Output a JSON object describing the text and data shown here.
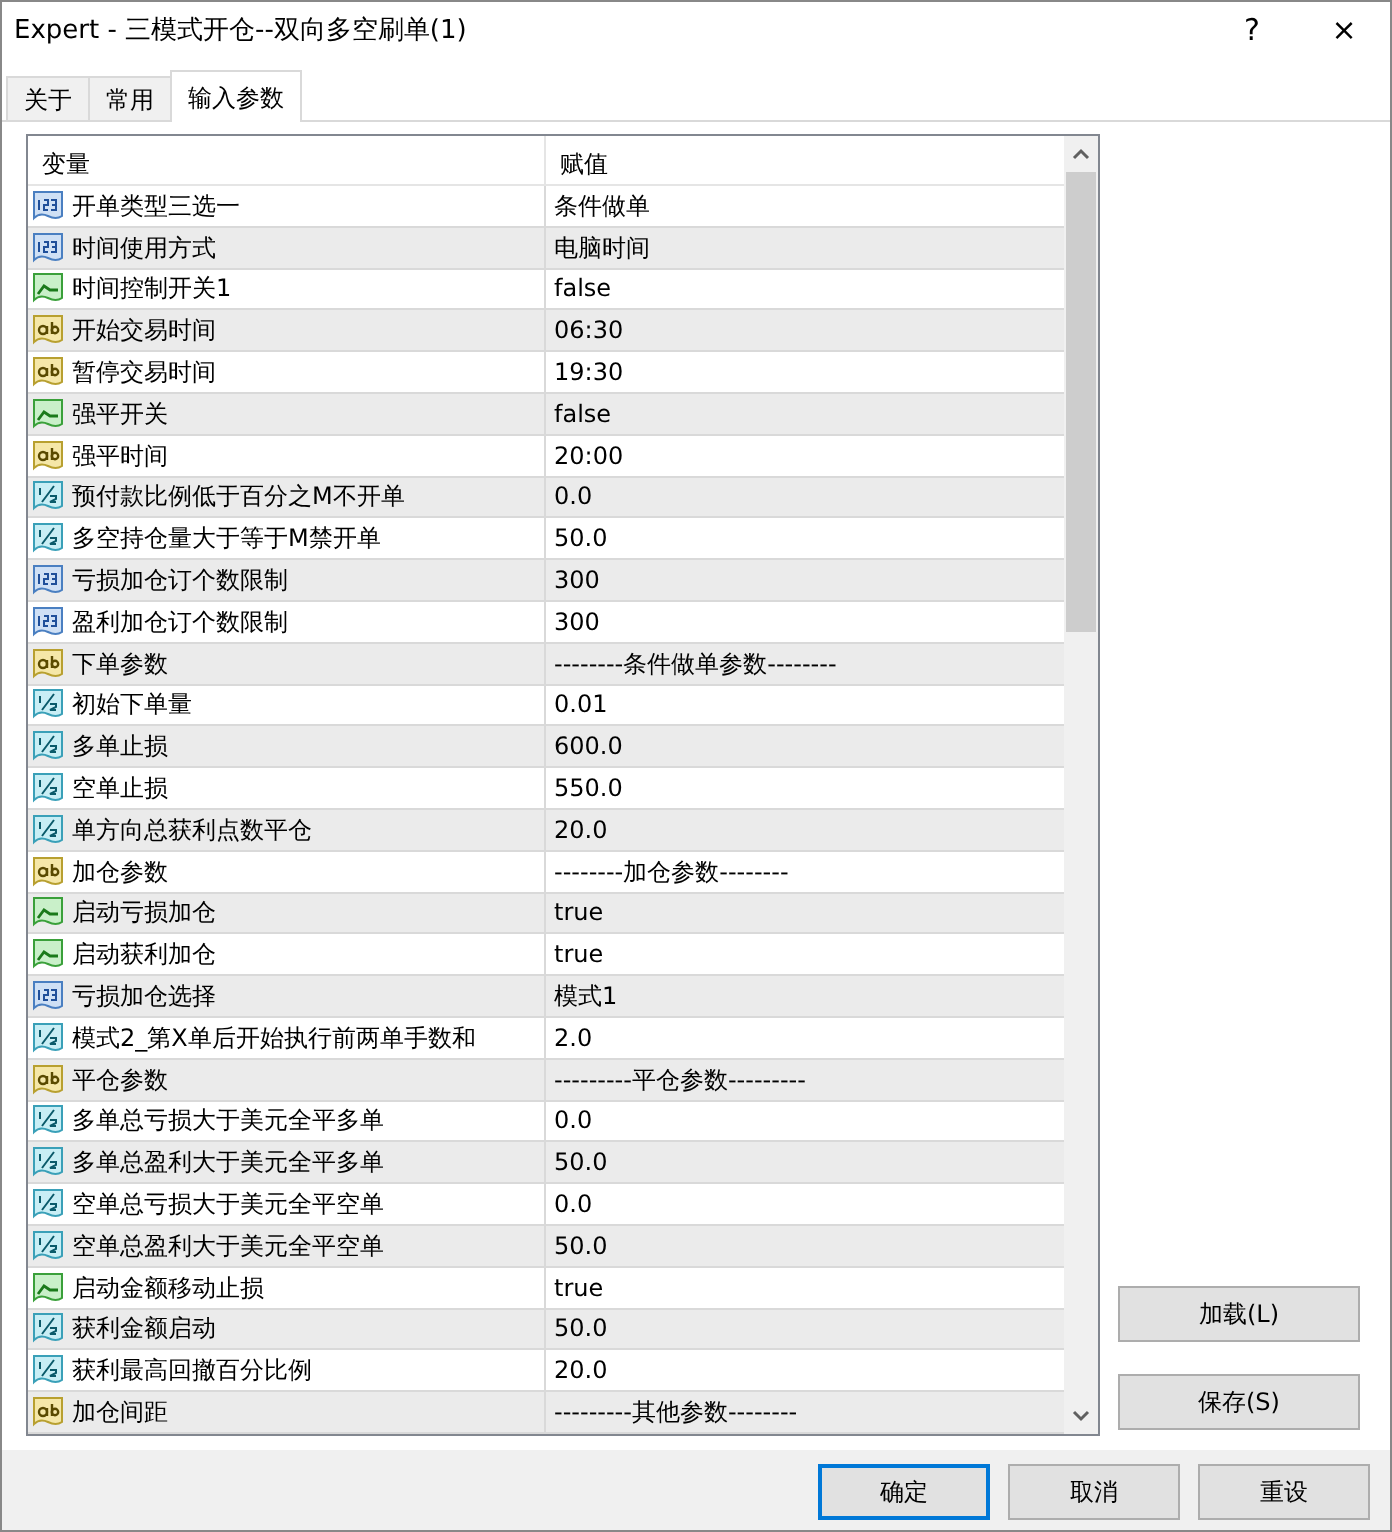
{
  "window": {
    "title": "Expert - 三模式开仓--双向多空刷单(1)",
    "help": "?",
    "close": "×"
  },
  "tabs": [
    {
      "label": "关于",
      "selected": false
    },
    {
      "label": "常用",
      "selected": false
    },
    {
      "label": "输入参数",
      "selected": true
    }
  ],
  "table": {
    "columns": [
      "变量",
      "赋值"
    ],
    "rows": [
      {
        "kind": "int",
        "name": "开单类型三选一",
        "value": "条件做单"
      },
      {
        "kind": "int",
        "name": "时间使用方式",
        "value": "电脑时间"
      },
      {
        "kind": "bool",
        "name": "时间控制开关1",
        "value": "false"
      },
      {
        "kind": "string",
        "name": "开始交易时间",
        "value": "06:30"
      },
      {
        "kind": "string",
        "name": "暂停交易时间",
        "value": "19:30"
      },
      {
        "kind": "bool",
        "name": "强平开关",
        "value": "false"
      },
      {
        "kind": "string",
        "name": "强平时间",
        "value": "20:00"
      },
      {
        "kind": "double",
        "name": "预付款比例低于百分之M不开单",
        "value": "0.0"
      },
      {
        "kind": "double",
        "name": "多空持仓量大于等于M禁开单",
        "value": "50.0"
      },
      {
        "kind": "int",
        "name": "亏损加仓订个数限制",
        "value": "300"
      },
      {
        "kind": "int",
        "name": "盈利加仓订个数限制",
        "value": "300"
      },
      {
        "kind": "string",
        "name": "下单参数",
        "value": "--------条件做单参数--------"
      },
      {
        "kind": "double",
        "name": "初始下单量",
        "value": "0.01"
      },
      {
        "kind": "double",
        "name": "多单止损",
        "value": "600.0"
      },
      {
        "kind": "double",
        "name": "空单止损",
        "value": "550.0"
      },
      {
        "kind": "double",
        "name": "单方向总获利点数平仓",
        "value": "20.0"
      },
      {
        "kind": "string",
        "name": "加仓参数",
        "value": "--------加仓参数--------"
      },
      {
        "kind": "bool",
        "name": "启动亏损加仓",
        "value": "true"
      },
      {
        "kind": "bool",
        "name": "启动获利加仓",
        "value": "true"
      },
      {
        "kind": "int",
        "name": "亏损加仓选择",
        "value": "模式1"
      },
      {
        "kind": "double",
        "name": "模式2_第X单后开始执行前两单手数和",
        "value": "2.0"
      },
      {
        "kind": "string",
        "name": "平仓参数",
        "value": "---------平仓参数---------"
      },
      {
        "kind": "double",
        "name": "多单总亏损大于美元全平多单",
        "value": "0.0"
      },
      {
        "kind": "double",
        "name": "多单总盈利大于美元全平多单",
        "value": "50.0"
      },
      {
        "kind": "double",
        "name": "空单总亏损大于美元全平空单",
        "value": "0.0"
      },
      {
        "kind": "double",
        "name": "空单总盈利大于美元全平空单",
        "value": "50.0"
      },
      {
        "kind": "bool",
        "name": "启动金额移动止损",
        "value": "true"
      },
      {
        "kind": "double",
        "name": "获利金额启动",
        "value": "50.0"
      },
      {
        "kind": "double",
        "name": "获利最高回撤百分比例",
        "value": "20.0"
      },
      {
        "kind": "string",
        "name": "加仓间距",
        "value": "---------其他参数--------"
      }
    ]
  },
  "side_buttons": [
    "加载(L)",
    "保存(S)"
  ],
  "buttons": [
    {
      "label": "确定",
      "default": true
    },
    {
      "label": "取消",
      "default": false
    },
    {
      "label": "重设",
      "default": false
    }
  ]
}
